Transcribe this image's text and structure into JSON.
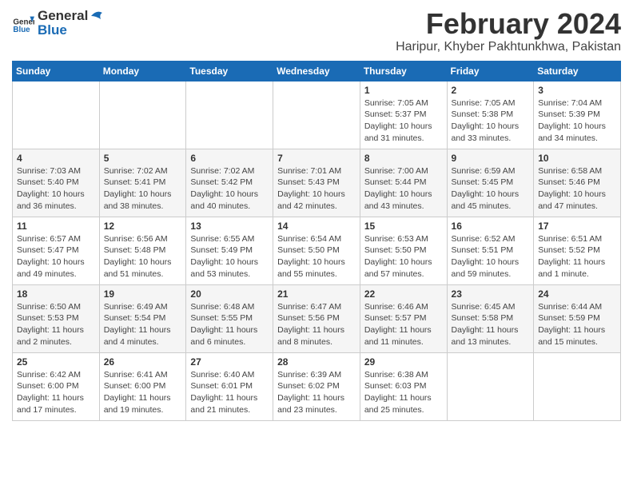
{
  "logo": {
    "general": "General",
    "blue": "Blue"
  },
  "title": {
    "month_year": "February 2024",
    "location": "Haripur, Khyber Pakhtunkhwa, Pakistan"
  },
  "days_of_week": [
    "Sunday",
    "Monday",
    "Tuesday",
    "Wednesday",
    "Thursday",
    "Friday",
    "Saturday"
  ],
  "weeks": [
    [
      {
        "day": "",
        "info": ""
      },
      {
        "day": "",
        "info": ""
      },
      {
        "day": "",
        "info": ""
      },
      {
        "day": "",
        "info": ""
      },
      {
        "day": "1",
        "info": "Sunrise: 7:05 AM\nSunset: 5:37 PM\nDaylight: 10 hours and 31 minutes."
      },
      {
        "day": "2",
        "info": "Sunrise: 7:05 AM\nSunset: 5:38 PM\nDaylight: 10 hours and 33 minutes."
      },
      {
        "day": "3",
        "info": "Sunrise: 7:04 AM\nSunset: 5:39 PM\nDaylight: 10 hours and 34 minutes."
      }
    ],
    [
      {
        "day": "4",
        "info": "Sunrise: 7:03 AM\nSunset: 5:40 PM\nDaylight: 10 hours and 36 minutes."
      },
      {
        "day": "5",
        "info": "Sunrise: 7:02 AM\nSunset: 5:41 PM\nDaylight: 10 hours and 38 minutes."
      },
      {
        "day": "6",
        "info": "Sunrise: 7:02 AM\nSunset: 5:42 PM\nDaylight: 10 hours and 40 minutes."
      },
      {
        "day": "7",
        "info": "Sunrise: 7:01 AM\nSunset: 5:43 PM\nDaylight: 10 hours and 42 minutes."
      },
      {
        "day": "8",
        "info": "Sunrise: 7:00 AM\nSunset: 5:44 PM\nDaylight: 10 hours and 43 minutes."
      },
      {
        "day": "9",
        "info": "Sunrise: 6:59 AM\nSunset: 5:45 PM\nDaylight: 10 hours and 45 minutes."
      },
      {
        "day": "10",
        "info": "Sunrise: 6:58 AM\nSunset: 5:46 PM\nDaylight: 10 hours and 47 minutes."
      }
    ],
    [
      {
        "day": "11",
        "info": "Sunrise: 6:57 AM\nSunset: 5:47 PM\nDaylight: 10 hours and 49 minutes."
      },
      {
        "day": "12",
        "info": "Sunrise: 6:56 AM\nSunset: 5:48 PM\nDaylight: 10 hours and 51 minutes."
      },
      {
        "day": "13",
        "info": "Sunrise: 6:55 AM\nSunset: 5:49 PM\nDaylight: 10 hours and 53 minutes."
      },
      {
        "day": "14",
        "info": "Sunrise: 6:54 AM\nSunset: 5:50 PM\nDaylight: 10 hours and 55 minutes."
      },
      {
        "day": "15",
        "info": "Sunrise: 6:53 AM\nSunset: 5:50 PM\nDaylight: 10 hours and 57 minutes."
      },
      {
        "day": "16",
        "info": "Sunrise: 6:52 AM\nSunset: 5:51 PM\nDaylight: 10 hours and 59 minutes."
      },
      {
        "day": "17",
        "info": "Sunrise: 6:51 AM\nSunset: 5:52 PM\nDaylight: 11 hours and 1 minute."
      }
    ],
    [
      {
        "day": "18",
        "info": "Sunrise: 6:50 AM\nSunset: 5:53 PM\nDaylight: 11 hours and 2 minutes."
      },
      {
        "day": "19",
        "info": "Sunrise: 6:49 AM\nSunset: 5:54 PM\nDaylight: 11 hours and 4 minutes."
      },
      {
        "day": "20",
        "info": "Sunrise: 6:48 AM\nSunset: 5:55 PM\nDaylight: 11 hours and 6 minutes."
      },
      {
        "day": "21",
        "info": "Sunrise: 6:47 AM\nSunset: 5:56 PM\nDaylight: 11 hours and 8 minutes."
      },
      {
        "day": "22",
        "info": "Sunrise: 6:46 AM\nSunset: 5:57 PM\nDaylight: 11 hours and 11 minutes."
      },
      {
        "day": "23",
        "info": "Sunrise: 6:45 AM\nSunset: 5:58 PM\nDaylight: 11 hours and 13 minutes."
      },
      {
        "day": "24",
        "info": "Sunrise: 6:44 AM\nSunset: 5:59 PM\nDaylight: 11 hours and 15 minutes."
      }
    ],
    [
      {
        "day": "25",
        "info": "Sunrise: 6:42 AM\nSunset: 6:00 PM\nDaylight: 11 hours and 17 minutes."
      },
      {
        "day": "26",
        "info": "Sunrise: 6:41 AM\nSunset: 6:00 PM\nDaylight: 11 hours and 19 minutes."
      },
      {
        "day": "27",
        "info": "Sunrise: 6:40 AM\nSunset: 6:01 PM\nDaylight: 11 hours and 21 minutes."
      },
      {
        "day": "28",
        "info": "Sunrise: 6:39 AM\nSunset: 6:02 PM\nDaylight: 11 hours and 23 minutes."
      },
      {
        "day": "29",
        "info": "Sunrise: 6:38 AM\nSunset: 6:03 PM\nDaylight: 11 hours and 25 minutes."
      },
      {
        "day": "",
        "info": ""
      },
      {
        "day": "",
        "info": ""
      }
    ]
  ]
}
